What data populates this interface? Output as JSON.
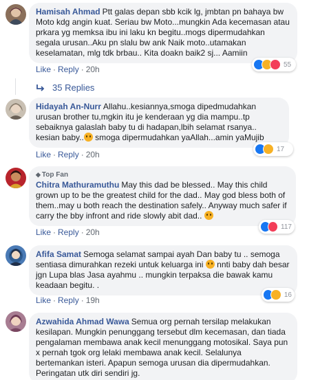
{
  "actions": {
    "like": "Like",
    "reply": "Reply",
    "separator": "·"
  },
  "comments": [
    {
      "author": "Hamisah Ahmad",
      "text": "Ptt galas depan sbb kcik lg, jmbtan pn bahaya bw Moto kdg angin kuat. Seriau bw Moto...mungkin Ada kecemasan atau prkara yg memksa ibu ini laku kn begitu..mogs dipermudahkan segala urusan..Aku pn slalu bw ank Naik moto..utamakan keselamatan, mlg tdk brbau.. Kita doakn baik2 sj... Aamiin",
      "time": "20h",
      "reaction_count": "55",
      "reactions": [
        "like-icon",
        "sad-icon",
        "love-icon"
      ]
    },
    {
      "author": "Hidayah An-Nurr",
      "text_before": "Allahu..kesiannya,smoga dipedmudahkan urusan brother tu,mgkin itu je kenderaan yg dia mampu..tp sebaiknya galaslah baby tu di hadapan,lbih selamat rsanya.. kesian baby..",
      "text_after": " smoga dipermudahkan yaAllah...amin yaMujib",
      "time": "20h",
      "reaction_count": "17",
      "reactions": [
        "like-icon",
        "sad-icon"
      ]
    },
    {
      "badge": "Top Fan",
      "author": "Chitra Mathuramuthu",
      "text": "May this dad be blessed.. May this child grown up to be the greatest child for the dad.. May god bless both of them..may u both reach the destination safely.. Anyway much safer if carry the bby infront and ride slowly abit dad..",
      "time": "20h",
      "reaction_count": "117",
      "reactions": [
        "like-icon",
        "love-icon"
      ]
    },
    {
      "author": "Afifa Samat",
      "text_before": "Semoga selamat sampai ayah Dan baby tu .. semoga sentiasa dimurahkan rezeki untuk keluarga ini",
      "text_after": " nnti baby dah besar jgn Lupa blas Jasa ayahmu .. mungkin terpaksa die bawak kamu keadaan begitu. .",
      "time": "19h",
      "reaction_count": "16",
      "reactions": [
        "like-icon",
        "sad-icon"
      ]
    },
    {
      "author": "Azwahida Ahmad Wawa",
      "text": "Semua org pernah tersilap melakukan kesilapan. Mungkin penunggang tersebut dlm kecemasan, dan tiada pengalaman membawa anak kecil menunggang motosikal. Saya pun x pernah tgok org lelaki membawa anak kecil. Selalunya bertemankan isteri. Apapun semoga urusan dia dipermudahkan. Peringatan utk diri sendiri jg."
    }
  ],
  "replies_label": "35 Replies",
  "colors": {
    "link": "#385898",
    "bubble": "#f2f3f5",
    "meta": "#606770"
  }
}
